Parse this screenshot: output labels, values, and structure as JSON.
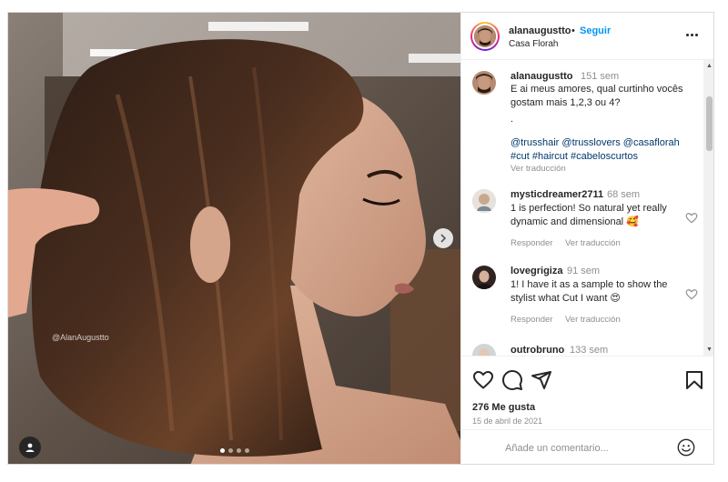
{
  "post": {
    "username": "alanaugustto",
    "separator": "•",
    "follow_label": "Seguir",
    "location": "Casa Florah",
    "watermark": "@AlanAugustto",
    "image_count": 4,
    "active_image": 1
  },
  "caption": {
    "username": "alanaugustto",
    "time": "151 sem",
    "text": "E ai meus amores, qual curtinho vocês gostam mais 1,2,3 ou 4?",
    "dot": ".",
    "tags": "@trusshair @trusslovers @casaflorah #cut #haircut #cabeloscurtos",
    "translate": "Ver traducción"
  },
  "comments": [
    {
      "username": "mysticdreamer2711",
      "time": "68 sem",
      "text": "1 is perfection! So natural yet really dynamic and dimensional 🥰",
      "reply": "Responder",
      "translate": "Ver traducción"
    },
    {
      "username": "lovegrigiza",
      "time": "91 sem",
      "text": "1! I have it as a sample to show the stylist what Cut I want 😍",
      "reply": "Responder",
      "translate": "Ver traducción"
    },
    {
      "username": "outrobruno",
      "time": "133 sem"
    }
  ],
  "stats": {
    "likes": "276 Me gusta",
    "date": "15 de abril de 2021"
  },
  "composer": {
    "placeholder": "Añade un comentario..."
  },
  "icons": {
    "more": "more-options-icon",
    "like": "heart-icon",
    "comment": "comment-icon",
    "share": "send-icon",
    "save": "bookmark-icon",
    "emoji": "emoji-icon",
    "next": "chevron-right-icon",
    "user_tag": "user-tag-icon"
  },
  "colors": {
    "link": "#0095f6",
    "hashtag": "#00376b",
    "muted": "#8e8e8e",
    "text": "#262626",
    "border": "#dbdbdb"
  }
}
